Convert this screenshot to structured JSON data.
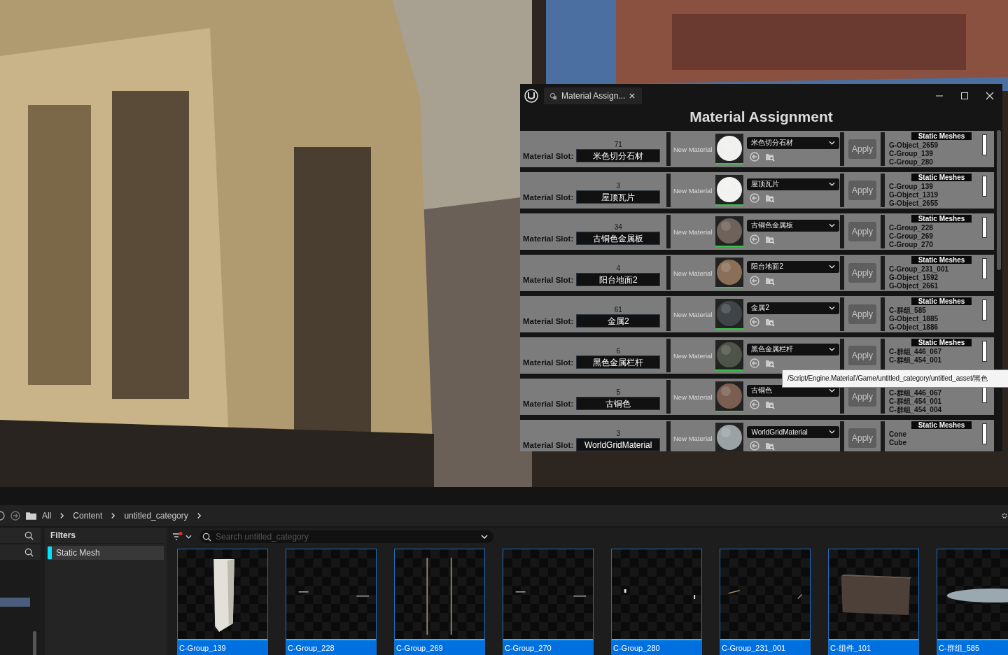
{
  "window": {
    "tab_title": "Material Assign...",
    "title": "Material Assignment"
  },
  "rows": [
    {
      "count": "71",
      "slot_label": "Material Slot:",
      "slot": "米色切分石材",
      "new_material": "New Material",
      "color": "#f0f0ee",
      "material": "米色切分石材",
      "apply": "Apply",
      "disabled": true,
      "meshes_header": "Static Meshes",
      "meshes": [
        "G-Object_2659",
        "C-Group_139",
        "C-Group_280"
      ]
    },
    {
      "count": "3",
      "slot_label": "Material Slot:",
      "slot": "屋顶瓦片",
      "new_material": "New Material",
      "color": "#f2f2f0",
      "material": "屋顶瓦片",
      "apply": "Apply",
      "disabled": true,
      "meshes_header": "Static Meshes",
      "meshes": [
        "C-Group_139",
        "G-Object_1319",
        "G-Object_2655"
      ]
    },
    {
      "count": "34",
      "slot_label": "Material Slot:",
      "slot": "古铜色金属板",
      "new_material": "New Material",
      "color": "#6e625a",
      "material": "古铜色金属板",
      "apply": "Apply",
      "disabled": true,
      "meshes_header": "Static Meshes",
      "meshes": [
        "C-Group_228",
        "C-Group_269",
        "C-Group_270"
      ]
    },
    {
      "count": "4",
      "slot_label": "Material Slot:",
      "slot": "阳台地面2",
      "new_material": "New Material",
      "color": "#8a7058",
      "material": "阳台地面2",
      "apply": "Apply",
      "disabled": true,
      "meshes_header": "Static Meshes",
      "meshes": [
        "C-Group_231_001",
        "G-Object_1592",
        "G-Object_2661"
      ]
    },
    {
      "count": "61",
      "slot_label": "Material Slot:",
      "slot": "金属2",
      "new_material": "New Material",
      "color": "#3e4448",
      "material": "金属2",
      "apply": "Apply",
      "disabled": true,
      "meshes_header": "Static Meshes",
      "meshes": [
        "C-群组_585",
        "G-Object_1885",
        "G-Object_1886"
      ]
    },
    {
      "count": "6",
      "slot_label": "Material Slot:",
      "slot": "黑色金属栏杆",
      "new_material": "New Material",
      "color": "#4e5448",
      "material": "黑色金属栏杆",
      "apply": "Apply",
      "disabled": true,
      "meshes_header": "Static Meshes",
      "meshes": [
        "C-群组_446_067",
        "C-群组_454_001"
      ]
    },
    {
      "count": "5",
      "slot_label": "Material Slot:",
      "slot": "古铜色",
      "new_material": "New Material",
      "color": "#7a5e50",
      "material": "古铜色",
      "apply": "Apply",
      "disabled": true,
      "meshes": [
        "C-群组_446_067",
        "C-群组_454_001",
        "C-群组_454_004"
      ]
    },
    {
      "count": "3",
      "slot_label": "Material Slot:",
      "slot": "WorldGridMaterial",
      "new_material": "New Material",
      "color": "#9aa2a6",
      "material": "WorldGridMaterial",
      "apply": "Apply",
      "disabled": true,
      "meshes_header": "Static Meshes",
      "meshes": [
        "Cone",
        "Cube"
      ]
    }
  ],
  "tooltip": "/Script/Engine.Material'/Game/untitled_category/untitled_asset/黑色",
  "breadcrumb": [
    "All",
    "Content",
    "untitled_category"
  ],
  "filters": {
    "title": "Filters",
    "items": [
      {
        "label": "Static Mesh",
        "color": "#00e5ff"
      }
    ]
  },
  "search": {
    "placeholder": "Search untitled_category"
  },
  "assets": [
    {
      "name": "C-Group_139",
      "kind": "panel"
    },
    {
      "name": "C-Group_228",
      "kind": "bits"
    },
    {
      "name": "C-Group_269",
      "kind": "rods"
    },
    {
      "name": "C-Group_270",
      "kind": "bits"
    },
    {
      "name": "C-Group_280",
      "kind": "dots"
    },
    {
      "name": "C-Group_231_001",
      "kind": "slants"
    },
    {
      "name": "C-组件_101",
      "kind": "box"
    },
    {
      "name": "C-群组_585",
      "kind": "disc"
    }
  ]
}
